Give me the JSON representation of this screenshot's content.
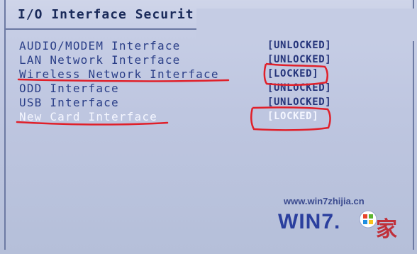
{
  "section": {
    "title": "I/O Interface Securit"
  },
  "interfaces": [
    {
      "label": "AUDIO/MODEM Interface",
      "status": "[UNLOCKED]"
    },
    {
      "label": "LAN Network Interface",
      "status": "[UNLOCKED]"
    },
    {
      "label": "Wireless Network Interface",
      "status": "[LOCKED]"
    },
    {
      "label": "ODD Interface",
      "status": "[UNLOCKED]"
    },
    {
      "label": "USB Interface",
      "status": "[UNLOCKED]"
    },
    {
      "label": "New Card Interface",
      "status": "[LOCKED]"
    }
  ],
  "selected_index": 5,
  "annotation_color": "#e0202a",
  "watermark": {
    "url": "www.win7zhijia.cn",
    "logo": "WIN7.",
    "char": "家"
  }
}
